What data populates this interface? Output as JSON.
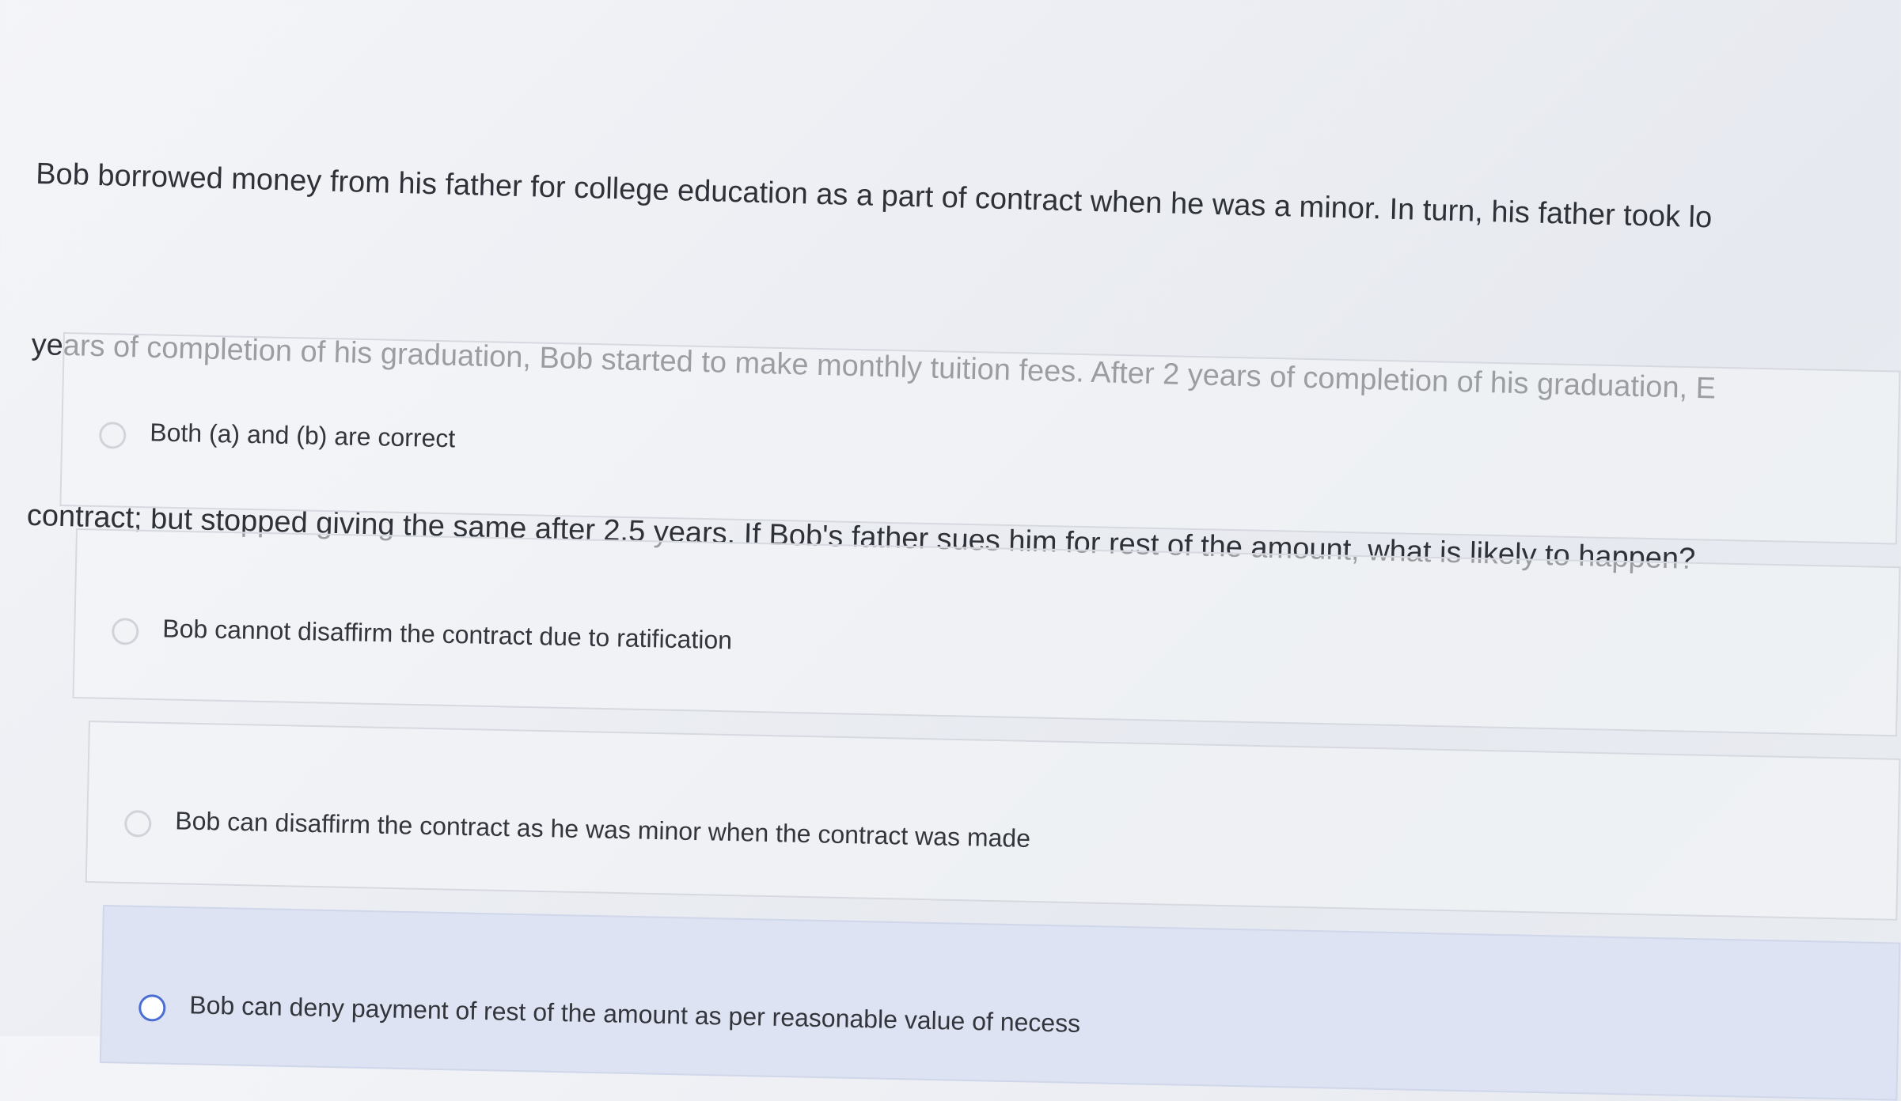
{
  "question": {
    "lines": [
      "Bob borrowed money from his father for college education as a part of contract when he was a minor. In turn, his father took lo",
      "years of completion of his graduation, Bob started to make monthly tuition fees. After 2 years of completion of his graduation, E",
      "contract; but stopped giving the same after 2.5 years. If Bob's father sues him for rest of the amount, what is likely to happen?"
    ]
  },
  "options": [
    {
      "label": "Both (a) and (b) are correct",
      "selected": false
    },
    {
      "label": "Bob cannot disaffirm the contract due to ratification",
      "selected": false
    },
    {
      "label": "Bob can disaffirm the contract as he was minor when the contract was made",
      "selected": false
    },
    {
      "label": "Bob can deny payment of rest of the amount as per reasonable value of necess",
      "selected": true
    }
  ],
  "colors": {
    "selected_background": "#dde3f2",
    "selected_radio": "#4a6fd0"
  }
}
